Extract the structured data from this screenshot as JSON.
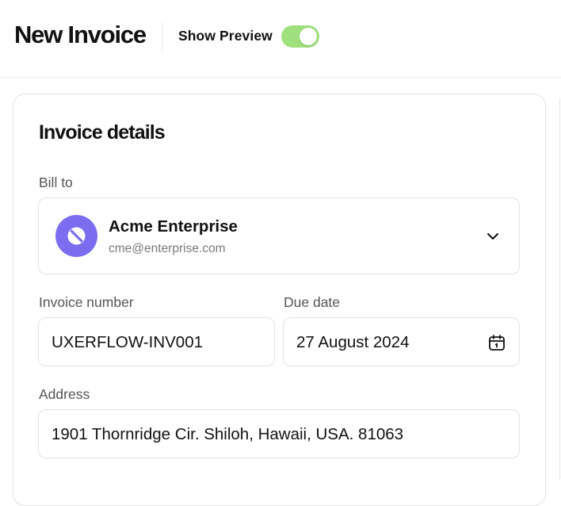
{
  "header": {
    "title": "New Invoice",
    "preview_label": "Show Preview",
    "preview_enabled": true,
    "toggle_color": "#9ee07d"
  },
  "section": {
    "title": "Invoice details"
  },
  "bill_to": {
    "label": "Bill to",
    "company_name": "Acme Enterprise",
    "company_email": "cme@enterprise.com",
    "avatar_color": "#7b6df0",
    "avatar_icon": "slashed-circle-icon",
    "dropdown_icon": "chevron-down-icon"
  },
  "invoice_number": {
    "label": "Invoice number",
    "value": "UXERFLOW-INV001"
  },
  "due_date": {
    "label": "Due date",
    "value": "27 August 2024",
    "icon": "calendar-icon"
  },
  "address": {
    "label": "Address",
    "value": "1901 Thornridge Cir. Shiloh, Hawaii, USA. 81063"
  }
}
